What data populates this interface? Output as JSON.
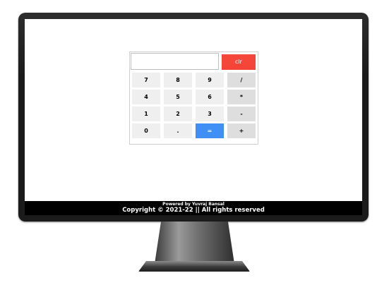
{
  "calculator": {
    "display_value": "",
    "clear_label": "clr",
    "keys": [
      [
        "7",
        "8",
        "9",
        "/"
      ],
      [
        "4",
        "5",
        "6",
        "*"
      ],
      [
        "1",
        "2",
        "3",
        "-"
      ],
      [
        "0",
        ".",
        "=",
        "+"
      ]
    ]
  },
  "footer": {
    "powered_by": "Powered by Yuvraj Bansal",
    "copyright": "Copyright © 2021-22 || All rights reserved"
  },
  "colors": {
    "clear_button": "#f44336",
    "equals_button": "#3f8ff5",
    "key": "#efefef",
    "operator_key": "#dedede",
    "footer_bg": "#000000"
  }
}
